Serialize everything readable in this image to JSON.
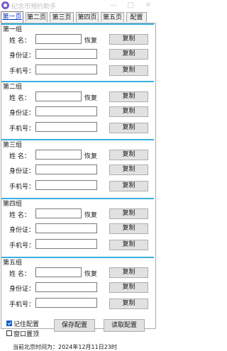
{
  "window": {
    "title": "纪念币预约助手",
    "minimize_symbol": "—",
    "maximize_symbol": "□",
    "close_symbol": "✕"
  },
  "tabs": [
    {
      "label": "第一页",
      "active": true
    },
    {
      "label": "第二页",
      "active": false
    },
    {
      "label": "第三页",
      "active": false
    },
    {
      "label": "第四页",
      "active": false
    },
    {
      "label": "第五页",
      "active": false
    },
    {
      "label": "配置",
      "active": false
    }
  ],
  "labels": {
    "name": "姓  名：",
    "id_card": "身份证：",
    "phone": "手机号：",
    "restore": "恢复",
    "copy": "复制"
  },
  "groups": [
    {
      "title": "第一组",
      "name_value": "",
      "id_value": "",
      "phone_value": ""
    },
    {
      "title": "第二组",
      "name_value": "",
      "id_value": "",
      "phone_value": ""
    },
    {
      "title": "第三组",
      "name_value": "",
      "id_value": "",
      "phone_value": ""
    },
    {
      "title": "第四组",
      "name_value": "",
      "id_value": "",
      "phone_value": ""
    },
    {
      "title": "第五组",
      "name_value": "",
      "id_value": "",
      "phone_value": ""
    }
  ],
  "bottom": {
    "remember_label": "记住配置",
    "remember_checked": true,
    "topmost_label": "窗口置顶",
    "topmost_checked": false,
    "save_label": "保存配置",
    "load_label": "读取配置"
  },
  "status": "当前北京时间为：2024年12月11日23时",
  "colors": {
    "group_line": "#3ab0e0",
    "active_tab_text": "#0a36c8",
    "checkbox_on": "#0a62d0"
  }
}
